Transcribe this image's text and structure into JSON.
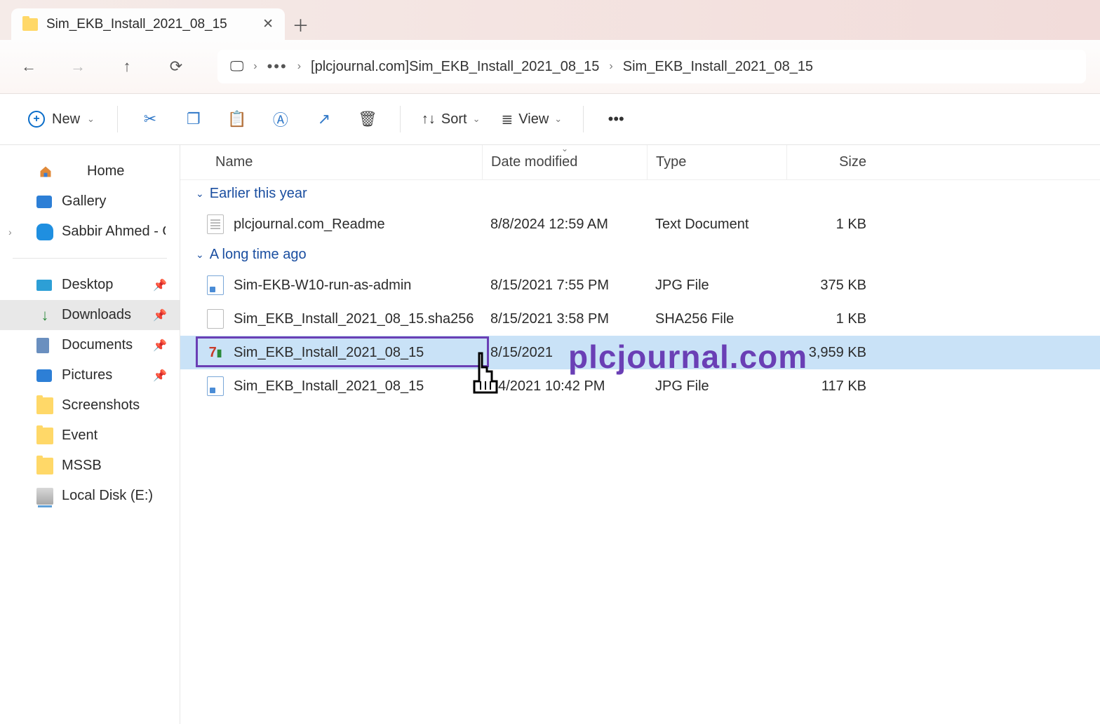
{
  "tab": {
    "title": "Sim_EKB_Install_2021_08_15"
  },
  "breadcrumb": {
    "seg1": "[plcjournal.com]Sim_EKB_Install_2021_08_15",
    "seg2": "Sim_EKB_Install_2021_08_15"
  },
  "toolbar": {
    "new": "New",
    "sort": "Sort",
    "view": "View"
  },
  "sidebar": {
    "home": "Home",
    "gallery": "Gallery",
    "onedrive": "Sabbir Ahmed - Glo",
    "desktop": "Desktop",
    "downloads": "Downloads",
    "documents": "Documents",
    "pictures": "Pictures",
    "screenshots": "Screenshots",
    "event": "Event",
    "mssb": "MSSB",
    "localdisk": "Local Disk (E:)"
  },
  "columns": {
    "name": "Name",
    "date": "Date modified",
    "type": "Type",
    "size": "Size"
  },
  "groups": {
    "g1": "Earlier this year",
    "g2": "A long time ago"
  },
  "files": {
    "f1": {
      "name": "plcjournal.com_Readme",
      "date": "8/8/2024 12:59 AM",
      "type": "Text Document",
      "size": "1 KB"
    },
    "f2": {
      "name": "Sim-EKB-W10-run-as-admin",
      "date": "8/15/2021 7:55 PM",
      "type": "JPG File",
      "size": "375 KB"
    },
    "f3": {
      "name": "Sim_EKB_Install_2021_08_15.sha256",
      "date": "8/15/2021 3:58 PM",
      "type": "SHA256 File",
      "size": "1 KB"
    },
    "f4": {
      "name": "Sim_EKB_Install_2021_08_15",
      "date": "8/15/2021",
      "type": "",
      "size": "3,959 KB"
    },
    "f5": {
      "name": "Sim_EKB_Install_2021_08_15",
      "date": "14/2021 10:42 PM",
      "type": "JPG File",
      "size": "117 KB"
    }
  },
  "watermark": "plcjournal.com"
}
